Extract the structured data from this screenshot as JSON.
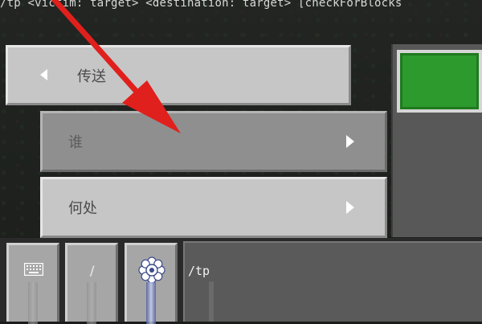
{
  "command_hint": "/tp <victim: target> <destination: target> [checkForBlocks",
  "menu": {
    "back_label": "传送",
    "options": [
      {
        "label": "谁"
      },
      {
        "label": "何处"
      }
    ]
  },
  "chat": {
    "input_value": "/tp",
    "slash_label": "/"
  },
  "colors": {
    "confirm_green": "#2d9a2d",
    "annotation_arrow": "#e0201c"
  },
  "icons": [
    "keyboard-icon",
    "slash-icon",
    "gear-icon",
    "back-chevron-icon",
    "chevron-right-icon"
  ]
}
